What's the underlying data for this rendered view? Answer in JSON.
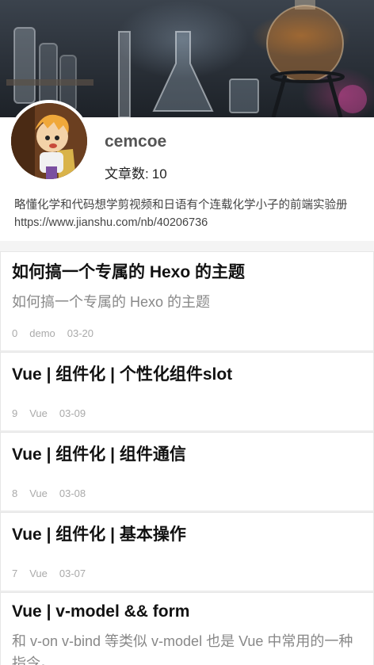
{
  "profile": {
    "username": "cemcoe",
    "post_count_label": "文章数:",
    "post_count": "10",
    "bio": "略懂化学和代码想学剪视频和日语有个连载化学小子的前端实验册https://www.jianshu.com/nb/40206736"
  },
  "posts": [
    {
      "title": "如何搞一个专属的 Hexo 的主题",
      "excerpt": "如何搞一个专属的 Hexo 的主题",
      "views": "0",
      "category": "demo",
      "date": "03-20"
    },
    {
      "title": "Vue | 组件化 | 个性化组件slot",
      "excerpt": "",
      "views": "9",
      "category": "Vue",
      "date": "03-09"
    },
    {
      "title": "Vue | 组件化 | 组件通信",
      "excerpt": "",
      "views": "8",
      "category": "Vue",
      "date": "03-08"
    },
    {
      "title": "Vue | 组件化 | 基本操作",
      "excerpt": "",
      "views": "7",
      "category": "Vue",
      "date": "03-07"
    },
    {
      "title": "Vue | v-model && form",
      "excerpt": "和 v-on v-bind 等类似 v-model 也是 Vue 中常用的一种指令。"
    }
  ]
}
